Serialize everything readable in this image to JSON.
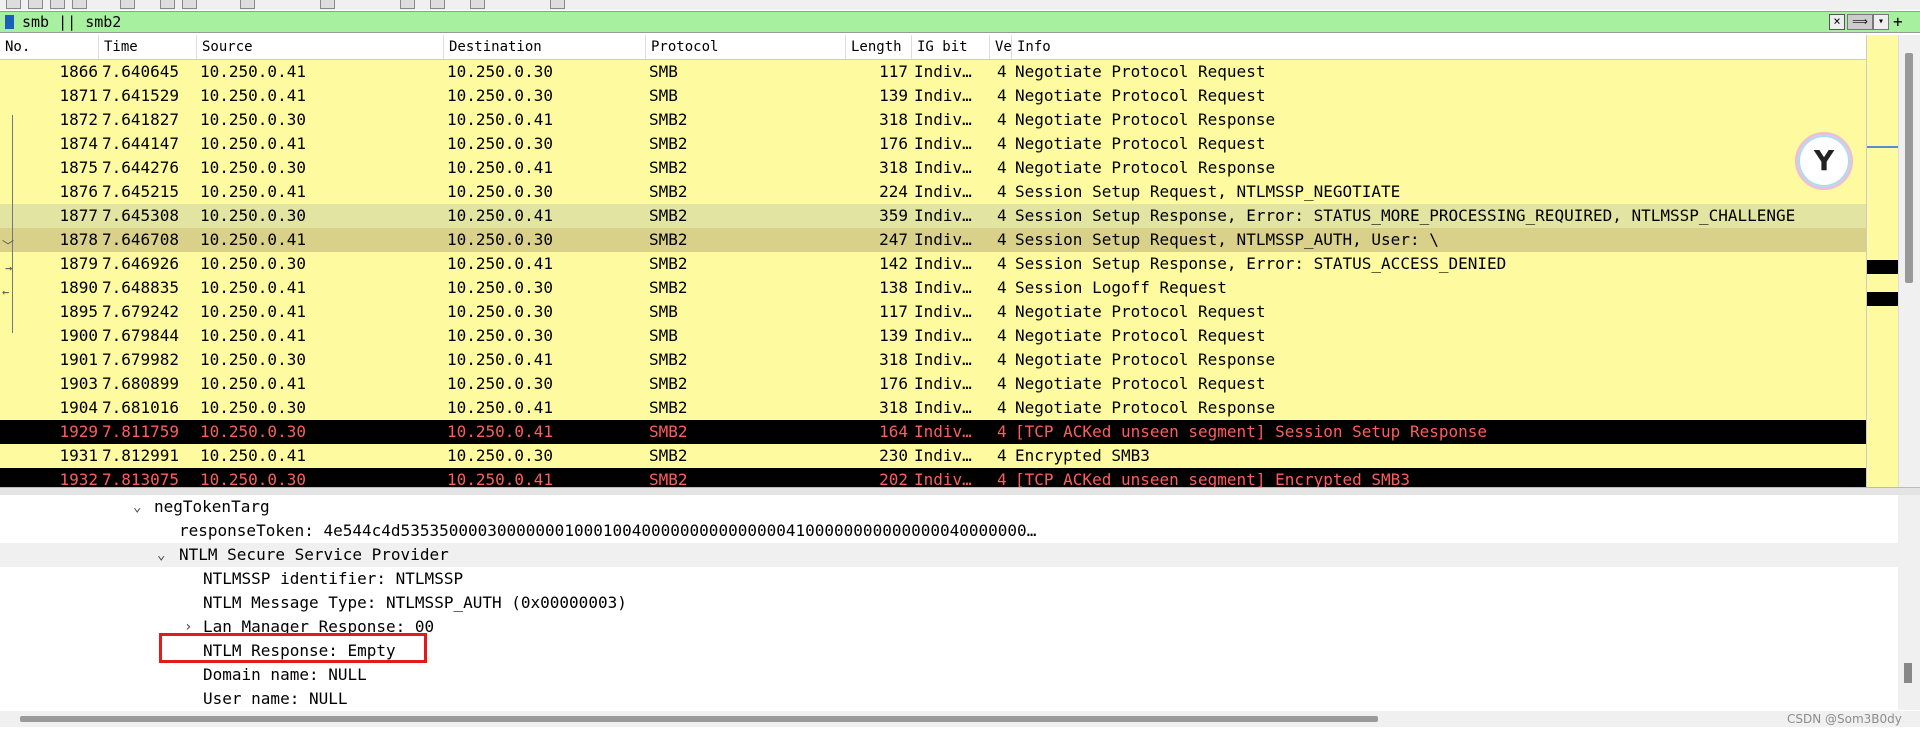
{
  "filter": {
    "text": "smb || smb2",
    "clear_icon": "×",
    "apply_icon": "⟹",
    "dropdown_icon": "▾",
    "add_icon": "+"
  },
  "packet_list": {
    "headers": {
      "no": "No.",
      "time": "Time",
      "source": "Source",
      "destination": "Destination",
      "protocol": "Protocol",
      "length": "Length",
      "ig_bit": "IG bit",
      "ve": "Ve",
      "info": "Info"
    },
    "rows": [
      {
        "no": "1866",
        "time": "7.640645",
        "src": "10.250.0.41",
        "dst": "10.250.0.30",
        "proto": "SMB",
        "len": "117",
        "ig": "Indiv…",
        "ve": "4",
        "info": "Negotiate Protocol Request",
        "style": "normal"
      },
      {
        "no": "1871",
        "time": "7.641529",
        "src": "10.250.0.41",
        "dst": "10.250.0.30",
        "proto": "SMB",
        "len": "139",
        "ig": "Indiv…",
        "ve": "4",
        "info": "Negotiate Protocol Request",
        "style": "normal"
      },
      {
        "no": "1872",
        "time": "7.641827",
        "src": "10.250.0.30",
        "dst": "10.250.0.41",
        "proto": "SMB2",
        "len": "318",
        "ig": "Indiv…",
        "ve": "4",
        "info": "Negotiate Protocol Response",
        "style": "normal"
      },
      {
        "no": "1874",
        "time": "7.644147",
        "src": "10.250.0.41",
        "dst": "10.250.0.30",
        "proto": "SMB2",
        "len": "176",
        "ig": "Indiv…",
        "ve": "4",
        "info": "Negotiate Protocol Request",
        "style": "normal"
      },
      {
        "no": "1875",
        "time": "7.644276",
        "src": "10.250.0.30",
        "dst": "10.250.0.41",
        "proto": "SMB2",
        "len": "318",
        "ig": "Indiv…",
        "ve": "4",
        "info": "Negotiate Protocol Response",
        "style": "normal"
      },
      {
        "no": "1876",
        "time": "7.645215",
        "src": "10.250.0.41",
        "dst": "10.250.0.30",
        "proto": "SMB2",
        "len": "224",
        "ig": "Indiv…",
        "ve": "4",
        "info": "Session Setup Request, NTLMSSP_NEGOTIATE",
        "style": "normal"
      },
      {
        "no": "1877",
        "time": "7.645308",
        "src": "10.250.0.30",
        "dst": "10.250.0.41",
        "proto": "SMB2",
        "len": "359",
        "ig": "Indiv…",
        "ve": "4",
        "info": "Session Setup Response, Error: STATUS_MORE_PROCESSING_REQUIRED, NTLMSSP_CHALLENGE",
        "style": "sel1"
      },
      {
        "no": "1878",
        "time": "7.646708",
        "src": "10.250.0.41",
        "dst": "10.250.0.30",
        "proto": "SMB2",
        "len": "247",
        "ig": "Indiv…",
        "ve": "4",
        "info": "Session Setup Request, NTLMSSP_AUTH, User: \\",
        "style": "sel2"
      },
      {
        "no": "1879",
        "time": "7.646926",
        "src": "10.250.0.30",
        "dst": "10.250.0.41",
        "proto": "SMB2",
        "len": "142",
        "ig": "Indiv…",
        "ve": "4",
        "info": "Session Setup Response, Error: STATUS_ACCESS_DENIED",
        "style": "normal"
      },
      {
        "no": "1890",
        "time": "7.648835",
        "src": "10.250.0.41",
        "dst": "10.250.0.30",
        "proto": "SMB2",
        "len": "138",
        "ig": "Indiv…",
        "ve": "4",
        "info": "Session Logoff Request",
        "style": "normal"
      },
      {
        "no": "1895",
        "time": "7.679242",
        "src": "10.250.0.41",
        "dst": "10.250.0.30",
        "proto": "SMB",
        "len": "117",
        "ig": "Indiv…",
        "ve": "4",
        "info": "Negotiate Protocol Request",
        "style": "normal"
      },
      {
        "no": "1900",
        "time": "7.679844",
        "src": "10.250.0.41",
        "dst": "10.250.0.30",
        "proto": "SMB",
        "len": "139",
        "ig": "Indiv…",
        "ve": "4",
        "info": "Negotiate Protocol Request",
        "style": "normal"
      },
      {
        "no": "1901",
        "time": "7.679982",
        "src": "10.250.0.30",
        "dst": "10.250.0.41",
        "proto": "SMB2",
        "len": "318",
        "ig": "Indiv…",
        "ve": "4",
        "info": "Negotiate Protocol Response",
        "style": "normal"
      },
      {
        "no": "1903",
        "time": "7.680899",
        "src": "10.250.0.41",
        "dst": "10.250.0.30",
        "proto": "SMB2",
        "len": "176",
        "ig": "Indiv…",
        "ve": "4",
        "info": "Negotiate Protocol Request",
        "style": "normal"
      },
      {
        "no": "1904",
        "time": "7.681016",
        "src": "10.250.0.30",
        "dst": "10.250.0.41",
        "proto": "SMB2",
        "len": "318",
        "ig": "Indiv…",
        "ve": "4",
        "info": "Negotiate Protocol Response",
        "style": "normal"
      },
      {
        "no": "1929",
        "time": "7.811759",
        "src": "10.250.0.30",
        "dst": "10.250.0.41",
        "proto": "SMB2",
        "len": "164",
        "ig": "Indiv…",
        "ve": "4",
        "info": "[TCP ACKed unseen segment] Session Setup Response",
        "style": "bad"
      },
      {
        "no": "1931",
        "time": "7.812991",
        "src": "10.250.0.41",
        "dst": "10.250.0.30",
        "proto": "SMB2",
        "len": "230",
        "ig": "Indiv…",
        "ve": "4",
        "info": "Encrypted SMB3",
        "style": "normal"
      },
      {
        "no": "1932",
        "time": "7.813075",
        "src": "10.250.0.30",
        "dst": "10.250.0.41",
        "proto": "SMB2",
        "len": "202",
        "ig": "Indiv…",
        "ve": "4",
        "info": "[TCP ACKed unseen segment] Encrypted SMB3",
        "style": "bad"
      }
    ]
  },
  "details": {
    "neg_token": "negTokenTarg",
    "response_token": "responseToken: 4e544c4d53535000030000000100010040000000000000004100000000000000040000000…",
    "ntlm_provider": "NTLM Secure Service Provider",
    "ntlmssp_identifier": "NTLMSSP identifier: NTLMSSP",
    "message_type": "NTLM Message Type: NTLMSSP_AUTH (0x00000003)",
    "lan_manager": "Lan Manager Response: 00",
    "ntlm_response": "NTLM Response: Empty",
    "domain_name": "Domain name: NULL",
    "user_name": "User name: NULL"
  },
  "watermark": "CSDN @Som3B0dy",
  "colors": {
    "row_normal": "#fdfaa0",
    "row_bad_bg": "#000000",
    "row_bad_text": "#ff5c5c",
    "filter_bg": "#a7f0a0",
    "highlight_box": "#e21a1a"
  }
}
